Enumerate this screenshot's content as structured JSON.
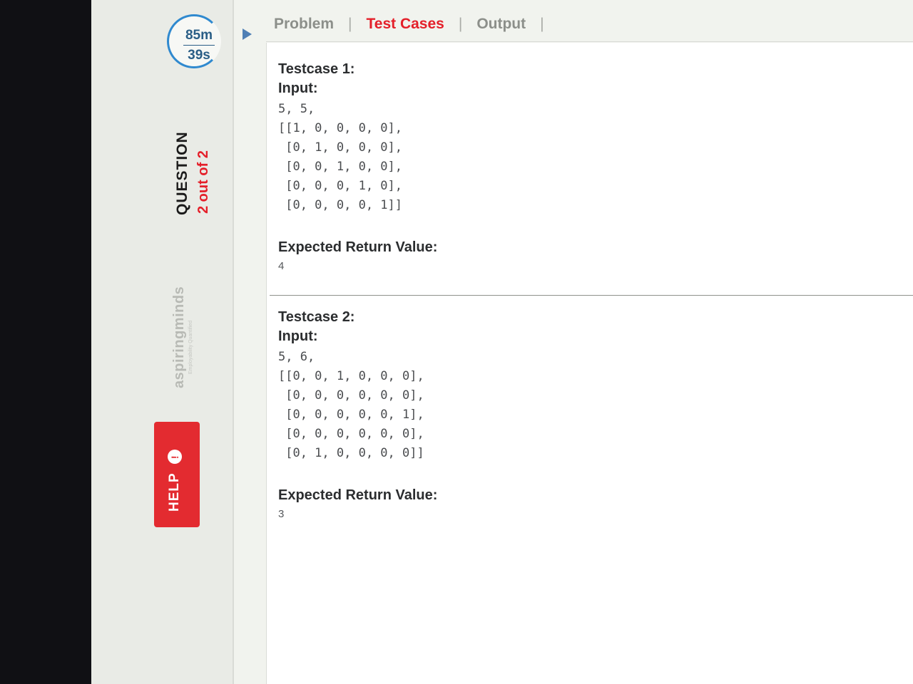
{
  "timer": {
    "minutes": "85m",
    "seconds": "39s"
  },
  "question": {
    "label": "QUESTION",
    "count": "2 out of 2"
  },
  "brand": {
    "name": "aspiringminds",
    "tagline": "Employability Quantified"
  },
  "help": {
    "label": "HELP",
    "icon": "info-icon"
  },
  "tabs": [
    {
      "label": "Problem",
      "active": false
    },
    {
      "label": "Test Cases",
      "active": true
    },
    {
      "label": "Output",
      "active": false
    }
  ],
  "tab_separator": "|",
  "testcases": [
    {
      "title": "Testcase 1:",
      "input_label": "Input:",
      "input_lines": [
        "5, 5,",
        "[[1, 0, 0, 0, 0],",
        " [0, 1, 0, 0, 0],",
        " [0, 0, 1, 0, 0],",
        " [0, 0, 0, 1, 0],",
        " [0, 0, 0, 0, 1]]"
      ],
      "expected_label": "Expected Return Value:",
      "expected_value": "4"
    },
    {
      "title": "Testcase 2:",
      "input_label": "Input:",
      "input_lines": [
        "5, 6,",
        "[[0, 0, 1, 0, 0, 0],",
        " [0, 0, 0, 0, 0, 0],",
        " [0, 0, 0, 0, 0, 1],",
        " [0, 0, 0, 0, 0, 0],",
        " [0, 1, 0, 0, 0, 0]]"
      ],
      "expected_label": "Expected Return Value:",
      "expected_value": "3"
    }
  ],
  "colors": {
    "accent_red": "#e4202a",
    "timer_blue": "#2f89cf",
    "help_red": "#e32b30"
  }
}
